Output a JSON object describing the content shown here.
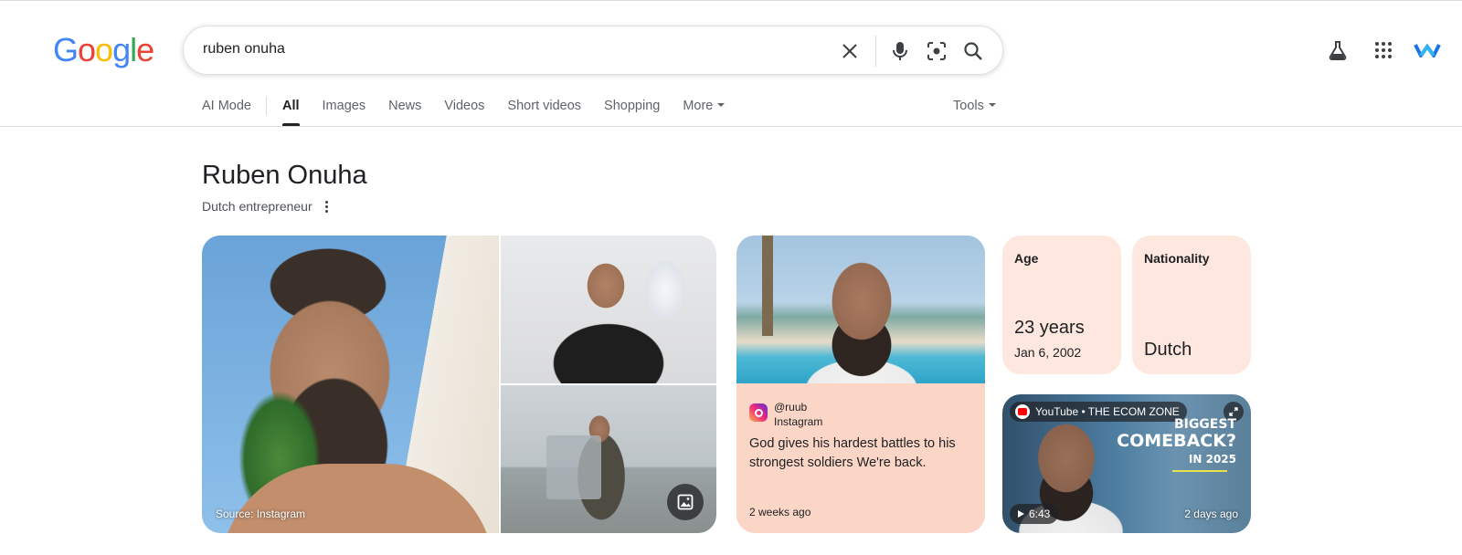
{
  "logo": {
    "letters": [
      "G",
      "o",
      "o",
      "g",
      "l",
      "e"
    ],
    "colors": [
      "#4285f4",
      "#ea4335",
      "#fbbc05",
      "#4285f4",
      "#34a853",
      "#ea4335"
    ]
  },
  "search": {
    "query": "ruben onuha"
  },
  "header_icons": [
    "clear-icon",
    "mic-icon",
    "lens-icon",
    "search-icon",
    "labs-flask-icon",
    "apps-grid-icon",
    "account-avatar-icon"
  ],
  "tabs": {
    "ai_mode": "AI Mode",
    "items": [
      "All",
      "Images",
      "News",
      "Videos",
      "Short videos",
      "Shopping",
      "More"
    ],
    "active": "All",
    "tools": "Tools"
  },
  "entity": {
    "title": "Ruben Onuha",
    "subtitle": "Dutch entrepreneur"
  },
  "images": {
    "main_source": "Source: Instagram"
  },
  "instagram": {
    "handle": "@ruub",
    "platform": "Instagram",
    "caption": "God gives his hardest battles to his strongest soldiers We're back.",
    "time": "2 weeks ago"
  },
  "facts": {
    "age": {
      "label": "Age",
      "value": "23 years",
      "detail": "Jan 6, 2002"
    },
    "nationality": {
      "label": "Nationality",
      "value": "Dutch"
    }
  },
  "video": {
    "source": "YouTube • THE ECOM ZONE",
    "title_lines": [
      "BIGGEST",
      "COMEBACK?",
      "IN 2025"
    ],
    "duration": "6:43",
    "age": "2 days ago"
  },
  "colors": {
    "accent_text": "#202124",
    "muted_text": "#5f6368",
    "card_peach": "#fbd6c6",
    "fact_bg": "#fde7de"
  }
}
